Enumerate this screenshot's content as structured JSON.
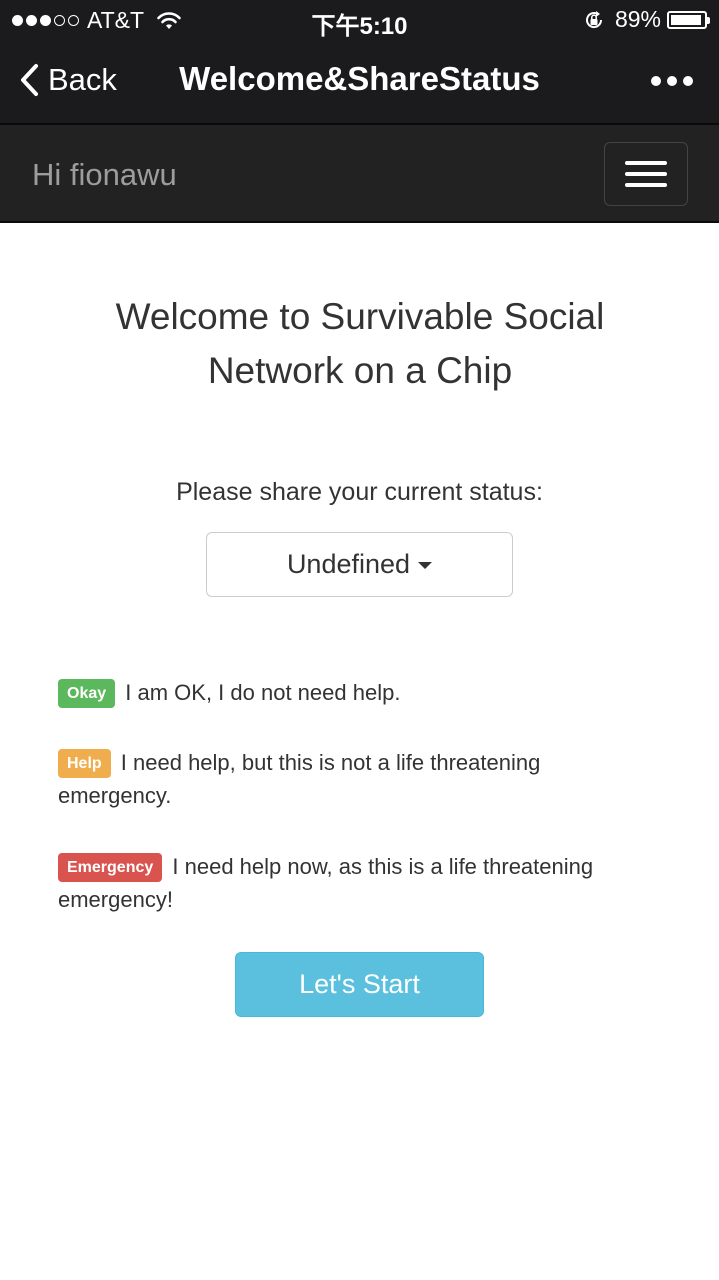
{
  "status_bar": {
    "carrier": "AT&T",
    "time": "下午5:10",
    "battery_percent": "89%",
    "battery_level": 0.89,
    "signal_bars_filled": 3,
    "signal_bars_total": 5
  },
  "nav": {
    "back_label": "Back",
    "title": "Welcome&ShareStatus"
  },
  "header": {
    "greeting": "Hi fionawu"
  },
  "main": {
    "welcome_line1": "Welcome to Survivable Social",
    "welcome_line2": "Network on a Chip",
    "prompt": "Please share your current status:",
    "status_value": "Undefined"
  },
  "legend": [
    {
      "badge": "Okay",
      "text": "I am OK, I do not need help.",
      "color": "#5cb85c"
    },
    {
      "badge": "Help",
      "text": "I need help, but this is not a life threatening emergency.",
      "color": "#f0ad4e"
    },
    {
      "badge": "Emergency",
      "text": "I need help now, as this is a life threatening emergency!",
      "color": "#d9534f"
    }
  ],
  "start_button_label": "Let's Start",
  "colors": {
    "bar_background": "#1b1b1d",
    "appbar_background": "#222222",
    "primary_button": "#5bc0de"
  }
}
